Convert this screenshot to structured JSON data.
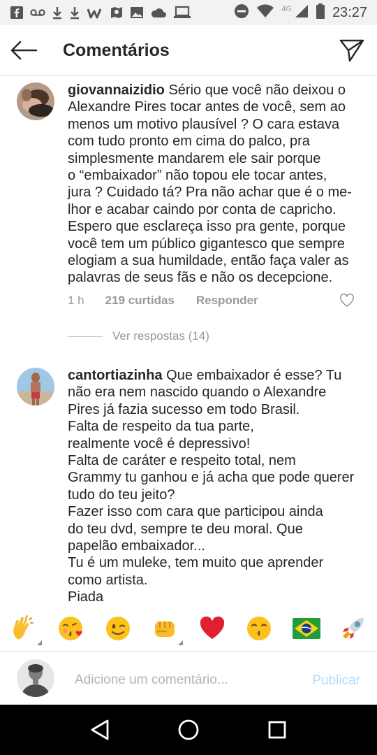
{
  "status_bar": {
    "time": "23:27",
    "network": "4G",
    "left_icons": [
      "facebook-icon",
      "voicemail-icon",
      "download-icon",
      "download-icon",
      "w-app-icon",
      "map-icon",
      "image-icon",
      "cloud-icon",
      "laptop-icon"
    ],
    "right_icons": [
      "do-not-disturb-icon",
      "wifi-icon",
      "signal-icon",
      "battery-icon"
    ]
  },
  "header": {
    "title": "Comentários"
  },
  "comments": [
    {
      "username": "giovannaizidio",
      "text": " Sério que você não deixou o\nAlexandre Pires tocar antes de você, sem ao\nmenos um motivo plausível ? O cara estava\ncom tudo pronto em cima do palco, pra\nsimplesmente mandarem ele sair porque\no “embaixador” não topou ele tocar antes,\njura ? Cuidado tá? Pra não achar que é o me-\nlhor e acabar caindo por conta de capricho.\nEspero que esclareça isso pra gente, porque\nvocê tem um público gigantesco que sempre\nelogiam a sua humildade, então faça valer as\npalavras de seus fãs e não os decepcione.",
      "time": "1 h",
      "likes": "219 curtidas",
      "reply": "Responder",
      "view_replies": "Ver respostas (14)"
    },
    {
      "username": "cantortiazinha",
      "text": " Que embaixador é esse? Tu\nnão era nem nascido quando o Alexandre\nPires já fazia sucesso em todo Brasil.\nFalta de respeito da tua parte,\nrealmente você é depressivo!\nFalta de caráter e respeito total, nem\nGrammy tu ganhou e já acha que pode querer\ntudo do teu jeito?\nFazer isso com cara que participou ainda\ndo teu dvd, sempre te deu moral. Que\npapelão embaixador...\nTu é um muleke, tem muito que aprender\ncomo artista.\nPiada"
    }
  ],
  "emoji_bar": [
    "👏",
    "😘",
    "😉",
    "👊",
    "❤️",
    "😙",
    "🇧🇷",
    "🚀"
  ],
  "input": {
    "placeholder": "Adicione um comentário...",
    "publish": "Publicar"
  },
  "colors": {
    "text": "#262626",
    "meta": "#999999",
    "publish_disabled": "#b3dbf9",
    "divider": "#dbdbdb"
  }
}
